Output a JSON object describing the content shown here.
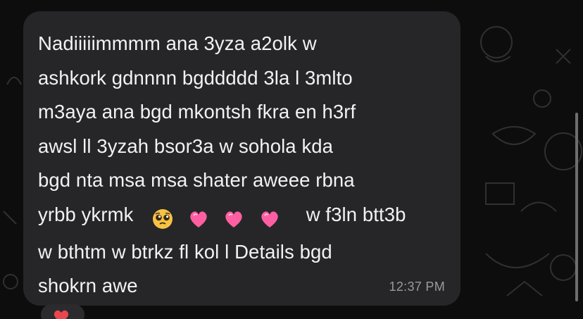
{
  "message": {
    "lines": [
      "Nadiiiiimmmm ana 3yza a2olk w",
      "ashkork gdnnnn bgddddd 3la l 3mlto",
      "m3aya ana bgd mkontsh fkra en h3rf",
      "awsl ll 3yzah bsor3a w sohola kda",
      "bgd nta msa msa shater aweee rbna",
      "yrbb ykrmk",
      "w f3ln btt3b",
      "w bthtm w btrkz fl kol l Details bgd",
      "shokrn awe"
    ],
    "emojis": [
      "pleading-face-emoji",
      "pink-heart-emoji",
      "pink-heart-emoji",
      "pink-heart-emoji"
    ],
    "time": "12:37 PM"
  },
  "colors": {
    "background": "#0d0d0d",
    "bubble": "#262628",
    "text": "#f2f2f2",
    "timestamp": "#9a9a9d",
    "heart": "#ff5fa2"
  }
}
